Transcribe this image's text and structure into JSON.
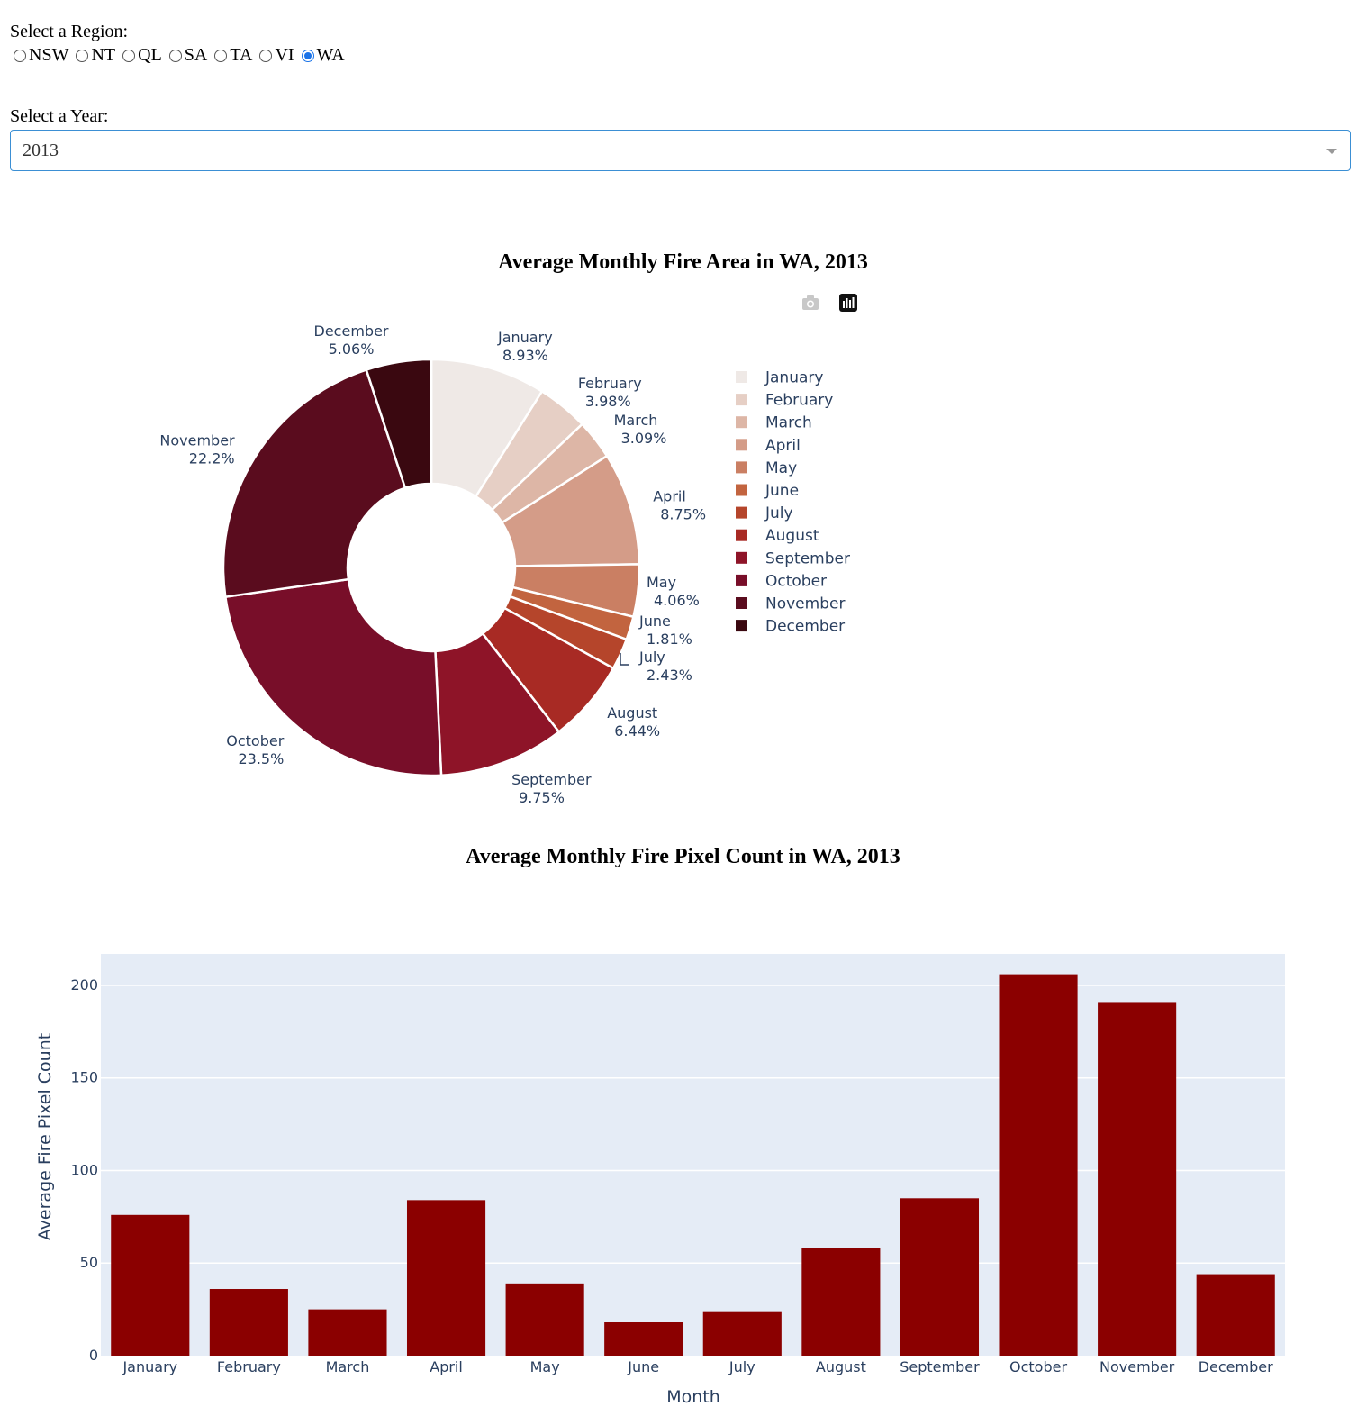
{
  "region_label": "Select a Region:",
  "regions": [
    {
      "label": "NSW",
      "selected": false
    },
    {
      "label": "NT",
      "selected": false
    },
    {
      "label": "QL",
      "selected": false
    },
    {
      "label": "SA",
      "selected": false
    },
    {
      "label": "TA",
      "selected": false
    },
    {
      "label": "VI",
      "selected": false
    },
    {
      "label": "WA",
      "selected": true
    }
  ],
  "year_label": "Select a Year:",
  "year_value": "2013",
  "toolbar": {
    "camera_icon": "camera-icon",
    "chart_icon": "bar-chart-icon"
  },
  "chart_data": [
    {
      "type": "pie",
      "hole": true,
      "title": "Average Monthly Fire Area in WA, 2013",
      "labels": [
        "January",
        "February",
        "March",
        "April",
        "May",
        "June",
        "July",
        "August",
        "September",
        "October",
        "November",
        "December"
      ],
      "values": [
        8.93,
        3.98,
        3.09,
        8.75,
        4.06,
        1.81,
        2.43,
        6.44,
        9.75,
        23.5,
        22.2,
        5.06
      ],
      "value_labels": [
        "8.93%",
        "3.98%",
        "3.09%",
        "8.75%",
        "4.06%",
        "1.81%",
        "2.43%",
        "6.44%",
        "9.75%",
        "23.5%",
        "22.2%",
        "5.06%"
      ],
      "colors": [
        "#efe9e6",
        "#e6cfc5",
        "#ddb6a6",
        "#d49c88",
        "#ca7f63",
        "#c2643f",
        "#b5452b",
        "#a82a24",
        "#8e1428",
        "#780e29",
        "#5a0c1e",
        "#3a0810"
      ],
      "legend": "right"
    },
    {
      "type": "bar",
      "title": "Average Monthly Fire Pixel Count in WA, 2013",
      "categories": [
        "January",
        "February",
        "March",
        "April",
        "May",
        "June",
        "July",
        "August",
        "September",
        "October",
        "November",
        "December"
      ],
      "values": [
        76,
        36,
        25,
        84,
        39,
        18,
        24,
        58,
        85,
        206,
        191,
        44
      ],
      "xlabel": "Month",
      "ylabel": "Average Fire Pixel Count",
      "yticks": [
        0,
        50,
        100,
        150,
        200
      ],
      "ylim": [
        0,
        217
      ],
      "color": "#8b0000",
      "plot_bg": "#e5ecf6",
      "grid": true
    }
  ]
}
